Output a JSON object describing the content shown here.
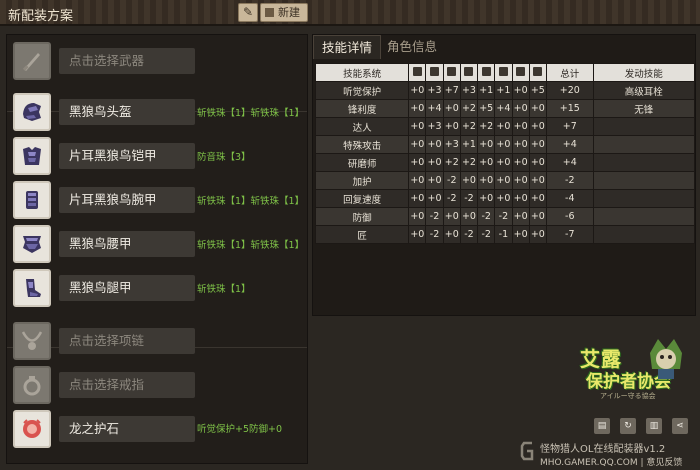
{
  "header": {
    "title": "新配装方案",
    "new_label": "新建"
  },
  "slots": [
    {
      "label": "点击选择武器",
      "placeholder": true,
      "icon": "weapon-icon",
      "decos": ""
    },
    {
      "label": "黑狼鸟头盔",
      "placeholder": false,
      "icon": "helmet-icon",
      "decos": "斩铁珠【1】斩铁珠【1】"
    },
    {
      "label": "片耳黑狼鸟铠甲",
      "placeholder": false,
      "icon": "chest-armor-icon",
      "decos": "防音珠【3】"
    },
    {
      "label": "片耳黑狼鸟腕甲",
      "placeholder": false,
      "icon": "arm-armor-icon",
      "decos": "斩铁珠【1】斩铁珠【1】"
    },
    {
      "label": "黑狼鸟腰甲",
      "placeholder": false,
      "icon": "waist-armor-icon",
      "decos": "斩铁珠【1】斩铁珠【1】"
    },
    {
      "label": "黑狼鸟腿甲",
      "placeholder": false,
      "icon": "leg-armor-icon",
      "decos": "斩铁珠【1】"
    },
    {
      "label": "点击选择项链",
      "placeholder": true,
      "icon": "necklace-icon",
      "decos": ""
    },
    {
      "label": "点击选择戒指",
      "placeholder": true,
      "icon": "ring-icon",
      "decos": ""
    },
    {
      "label": "龙之护石",
      "placeholder": false,
      "icon": "talisman-icon",
      "decos": "听觉保护+5防御+0"
    }
  ],
  "tabs": {
    "active": "技能详情",
    "inactive": "角色信息"
  },
  "skills_table": {
    "headers": {
      "name": "技能系统",
      "total": "总计",
      "activated": "发动技能"
    },
    "column_icons": [
      "weapon-icon",
      "helmet-icon",
      "chest-icon",
      "arm-icon",
      "waist-icon",
      "leg-icon",
      "necklace-icon",
      "ring-icon"
    ],
    "rows": [
      {
        "name": "听觉保护",
        "vals": [
          "+0",
          "+3",
          "+7",
          "+3",
          "+1",
          "+1",
          "+0",
          "+5"
        ],
        "total": "+20",
        "act": "高级耳栓"
      },
      {
        "name": "锋利度",
        "vals": [
          "+0",
          "+4",
          "+0",
          "+2",
          "+5",
          "+4",
          "+0",
          "+0"
        ],
        "total": "+15",
        "act": "无锋"
      },
      {
        "name": "达人",
        "vals": [
          "+0",
          "+3",
          "+0",
          "+2",
          "+2",
          "+0",
          "+0",
          "+0"
        ],
        "total": "+7",
        "act": ""
      },
      {
        "name": "特殊攻击",
        "vals": [
          "+0",
          "+0",
          "+3",
          "+1",
          "+0",
          "+0",
          "+0",
          "+0"
        ],
        "total": "+4",
        "act": ""
      },
      {
        "name": "研磨师",
        "vals": [
          "+0",
          "+0",
          "+2",
          "+2",
          "+0",
          "+0",
          "+0",
          "+0"
        ],
        "total": "+4",
        "act": ""
      },
      {
        "name": "加护",
        "vals": [
          "+0",
          "+0",
          "-2",
          "+0",
          "+0",
          "+0",
          "+0",
          "+0"
        ],
        "total": "-2",
        "act": ""
      },
      {
        "name": "回复速度",
        "vals": [
          "+0",
          "+0",
          "-2",
          "-2",
          "+0",
          "+0",
          "+0",
          "+0"
        ],
        "total": "-4",
        "act": ""
      },
      {
        "name": "防御",
        "vals": [
          "+0",
          "-2",
          "+0",
          "+0",
          "-2",
          "-2",
          "+0",
          "+0"
        ],
        "total": "-6",
        "act": ""
      },
      {
        "name": "匠",
        "vals": [
          "+0",
          "-2",
          "+0",
          "-2",
          "-2",
          "-1",
          "+0",
          "+0"
        ],
        "total": "-7",
        "act": ""
      }
    ]
  },
  "logo": {
    "line1": "艾露",
    "line2": "保护者协会",
    "line3": "アイルー守る協会"
  },
  "footer": {
    "line1": "怪物猎人OL在线配装器v1.2",
    "line2": "MHO.GAMER.QQ.COM | 意见反馈"
  }
}
